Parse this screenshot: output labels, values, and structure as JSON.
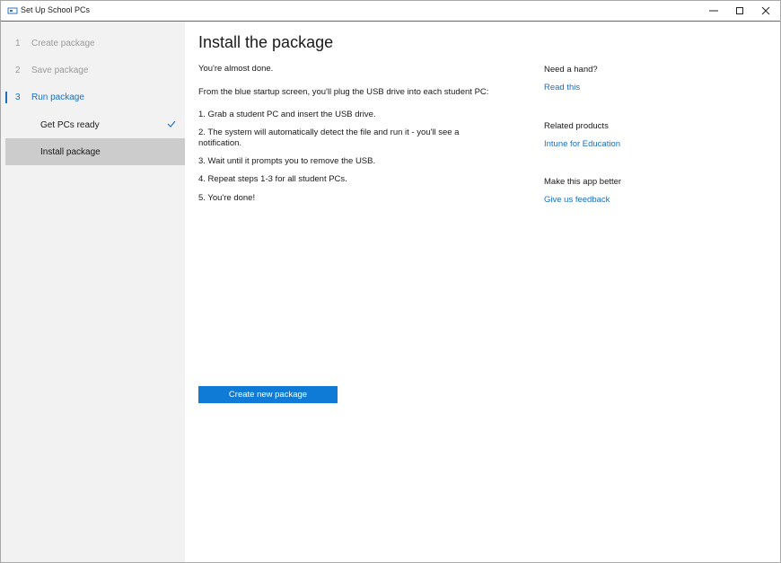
{
  "window": {
    "title": "Set Up School PCs",
    "controls": [
      "minimize-icon",
      "maximize-icon",
      "close-icon"
    ]
  },
  "sidebar": {
    "steps": [
      {
        "num": "1",
        "label": "Create package"
      },
      {
        "num": "2",
        "label": "Save package"
      },
      {
        "num": "3",
        "label": "Run package"
      }
    ],
    "substeps": [
      {
        "label": "Get PCs ready",
        "done": true
      },
      {
        "label": "Install package",
        "selected": true
      }
    ]
  },
  "main": {
    "title": "Install the package",
    "intro": "You're almost done.",
    "instructions": "From the blue startup screen, you'll plug the USB drive into each student PC:",
    "steps": [
      "1. Grab a student PC and insert the USB drive.",
      "2. The system will automatically detect the file and run it - you'll see a notification.",
      "3. Wait until it prompts you to remove the USB.",
      "4. Repeat steps 1-3 for all student PCs.",
      "5. You're done!"
    ],
    "primary_button": "Create new package"
  },
  "aside": {
    "help_heading": "Need a hand?",
    "help_link": "Read this",
    "related_heading": "Related products",
    "related_link": "Intune for Education",
    "feedback_heading": "Make this app better",
    "feedback_link": "Give us feedback"
  },
  "colors": {
    "accent": "#1a6fc1",
    "button": "#0f7bd6",
    "sidebar_bg": "#f2f2f2",
    "selected_bg": "#cccccc"
  }
}
